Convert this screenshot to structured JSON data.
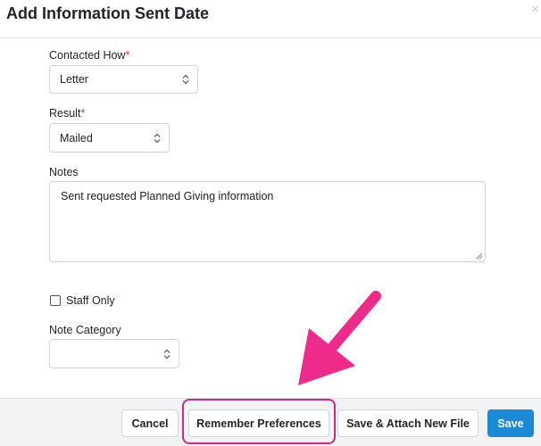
{
  "dialog": {
    "title": "Add Information Sent Date",
    "close_glyph": "✕"
  },
  "form": {
    "contacted_how": {
      "label": "Contacted How",
      "required": "*",
      "value": "Letter"
    },
    "result": {
      "label": "Result",
      "required": "*",
      "value": "Mailed"
    },
    "notes": {
      "label": "Notes",
      "value": "Sent requested Planned Giving information"
    },
    "staff_only": {
      "label": "Staff Only",
      "checked": false
    },
    "note_category": {
      "label": "Note Category",
      "value": ""
    }
  },
  "footer": {
    "cancel_label": "Cancel",
    "remember_label": "Remember Preferences",
    "save_attach_label": "Save & Attach New File",
    "save_label": "Save"
  },
  "annotation": {
    "highlight_color": "#d6287d",
    "arrow_icon": "arrow-down-left-icon"
  },
  "colors": {
    "primary": "#1a8ad6",
    "required": "#dc3545",
    "footer_bg": "#f1f3f5"
  }
}
